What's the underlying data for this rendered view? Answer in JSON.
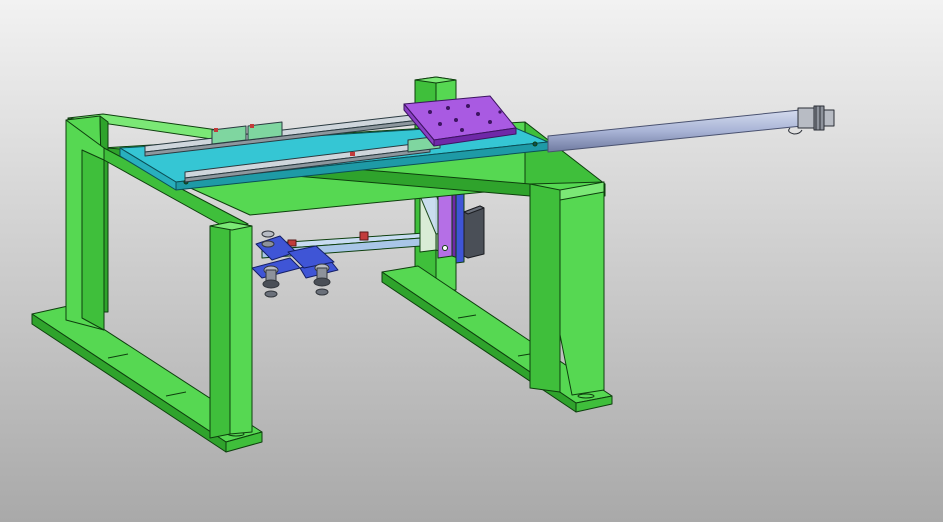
{
  "viewport": {
    "background_top": "#f2f2f2",
    "background_bottom": "#a9a9a9"
  },
  "colors": {
    "frame_fill": "#56d852",
    "frame_dark": "#2fa32c",
    "frame_light": "#7be876",
    "frame_edge": "#0e3f0e",
    "cyan_plate": "#35c6d4",
    "cyan_dark": "#1e9aa6",
    "purple": "#9a45d8",
    "purple_dark": "#6f28a8",
    "blue": "#3f55d6",
    "rod": "#a9b4d6",
    "rod_dark": "#6f7aa0",
    "beam": "#a9c6e8",
    "dark_block": "#4a4f57",
    "hardware": "#b8bcc4"
  },
  "components": [
    "frame",
    "linear-guide-rails",
    "mounting-plate",
    "carriage-plate",
    "actuator-rod",
    "gripper-arm",
    "suction-cups"
  ]
}
